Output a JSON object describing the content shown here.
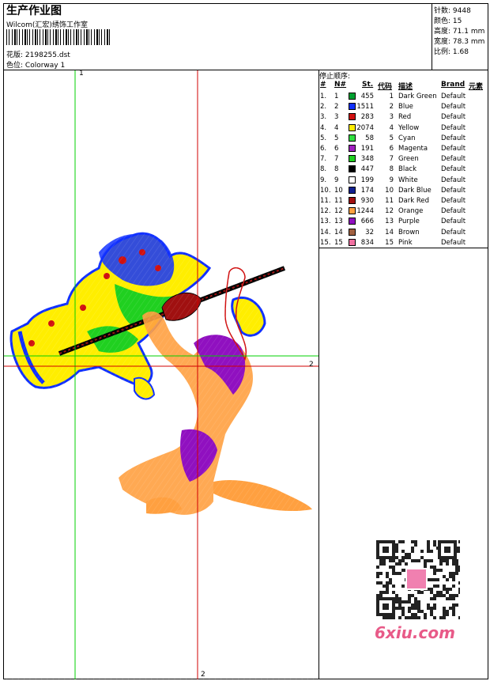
{
  "header": {
    "title": "生产作业图",
    "company": "Wilcom(汇宏)绣饰工作室",
    "design_label": "花版:",
    "design_value": "2198255.dst",
    "colorway_label": "色位:",
    "colorway_value": "Colorway 1"
  },
  "stats": {
    "stitches_label": "针数:",
    "stitches_value": "9448",
    "colors_label": "颜色:",
    "colors_value": "15",
    "height_label": "高度:",
    "height_value": "71.1 mm",
    "width_label": "宽度:",
    "width_value": "78.3 mm",
    "ratio_label": "比例:",
    "ratio_value": "1.68"
  },
  "stop_sequence": {
    "title": "停止顺序:",
    "headers": [
      "#",
      "N#",
      "St.",
      "代码",
      "描述",
      "Brand",
      "元素"
    ],
    "rows": [
      {
        "idx": "1.",
        "n": "1",
        "st": "455",
        "code": "1",
        "desc": "Dark Green",
        "brand": "Default",
        "color": "#00a030"
      },
      {
        "idx": "2.",
        "n": "2",
        "st": "1511",
        "code": "2",
        "desc": "Blue",
        "brand": "Default",
        "color": "#1030ff"
      },
      {
        "idx": "3.",
        "n": "3",
        "st": "283",
        "code": "3",
        "desc": "Red",
        "brand": "Default",
        "color": "#d01010"
      },
      {
        "idx": "4.",
        "n": "4",
        "st": "2074",
        "code": "4",
        "desc": "Yellow",
        "brand": "Default",
        "color": "#ffee00"
      },
      {
        "idx": "5.",
        "n": "5",
        "st": "58",
        "code": "5",
        "desc": "Cyan",
        "brand": "Default",
        "color": "#30e040"
      },
      {
        "idx": "6.",
        "n": "6",
        "st": "191",
        "code": "6",
        "desc": "Magenta",
        "brand": "Default",
        "color": "#a020c0"
      },
      {
        "idx": "7.",
        "n": "7",
        "st": "348",
        "code": "7",
        "desc": "Green",
        "brand": "Default",
        "color": "#20d020"
      },
      {
        "idx": "8.",
        "n": "8",
        "st": "447",
        "code": "8",
        "desc": "Black",
        "brand": "Default",
        "color": "#000000"
      },
      {
        "idx": "9.",
        "n": "9",
        "st": "199",
        "code": "9",
        "desc": "White",
        "brand": "Default",
        "color": "#ffffff"
      },
      {
        "idx": "10.",
        "n": "10",
        "st": "174",
        "code": "10",
        "desc": "Dark Blue",
        "brand": "Default",
        "color": "#102090"
      },
      {
        "idx": "11.",
        "n": "11",
        "st": "930",
        "code": "11",
        "desc": "Dark Red",
        "brand": "Default",
        "color": "#a01010"
      },
      {
        "idx": "12.",
        "n": "12",
        "st": "1244",
        "code": "12",
        "desc": "Orange",
        "brand": "Default",
        "color": "#ffa040"
      },
      {
        "idx": "13.",
        "n": "13",
        "st": "666",
        "code": "13",
        "desc": "Purple",
        "brand": "Default",
        "color": "#9010c0"
      },
      {
        "idx": "14.",
        "n": "14",
        "st": "32",
        "code": "14",
        "desc": "Brown",
        "brand": "Default",
        "color": "#a06040"
      },
      {
        "idx": "15.",
        "n": "15",
        "st": "834",
        "code": "15",
        "desc": "Pink",
        "brand": "Default",
        "color": "#f070a0"
      }
    ]
  },
  "axis_labels": {
    "top": "1",
    "right": "2",
    "bottom": "2"
  },
  "watermark": "6xiu.com"
}
